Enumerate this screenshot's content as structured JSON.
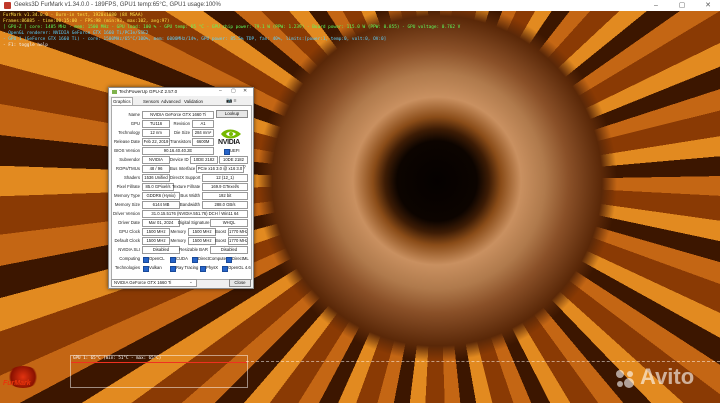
{
  "window": {
    "title": "Geeks3D FurMark v1.34.0.0 - 189FPS, GPU1 temp:65°C, GPU1 usage:100%",
    "controls": [
      "–",
      "▢",
      "✕"
    ]
  },
  "osd": {
    "line1": "FurMark v1.34.0.0 - Burn-in test, 1920x1080 (8X MSAA)",
    "line2": "Frames:86885 - time:00:15:00 - FPS:98 (min:93, max:102, avg:97)",
    "line3": "[ GPU-Z ] core: 1485 MHz - mem: 1500 MHz - GPU load: 100 % - GPU temp: 65 °C - GPU chip power: 79.1 W (PPW: 1.239) - Board power: 115.0 W (PPW: 0.855) - GPU voltage: 0.762 V",
    "line4": "- OpenGL renderer: NVIDIA GeForce GTX 1660 Ti/PCIe/SSE2",
    "line5": "- GPU 1 (GeForce GTX 1660 Ti) - core: 1500MHz/65°C/100%, mem: 6000MHz/14%, GPU power: 85.5% TDP, fan: 40%, limits:[power:1, temp:0, volt:0, OV:0]",
    "line6": "- F1: toggle help"
  },
  "graph": {
    "label": "GPU 1: 65°C (min: 51°C - max: 65°C)"
  },
  "logo": "FurMark",
  "watermark": "Avito",
  "gpuz": {
    "title": "TechPowerUp GPU-Z 2.57.0",
    "title_buttons": [
      "–",
      "▢",
      "✕"
    ],
    "tabs": [
      "Graphics Card",
      "Sensors",
      "Advanced",
      "Validation"
    ],
    "tab_icons": [
      "📷",
      "≡"
    ],
    "name_label": "Name",
    "name_value": "NVIDIA GeForce GTX 1660 Ti",
    "lookup": "Lookup",
    "gpu_label": "GPU",
    "gpu_value": "TU116",
    "revision_label": "Revision",
    "revision_value": "A1",
    "technology_label": "Technology",
    "technology_value": "12 nm",
    "diesize_label": "Die Size",
    "diesize_value": "284 mm²",
    "release_label": "Release Date",
    "release_value": "Feb 22, 2019",
    "transistors_label": "Transistors",
    "transistors_value": "6600M",
    "bios_label": "BIOS Version",
    "bios_value": "90.16.40.40.2E",
    "uefi": "UEFI",
    "subvendor_label": "Subvendor",
    "subvendor_value": "NVIDIA",
    "deviceid_label": "Device ID",
    "deviceid_value1": "10DE 2182",
    "deviceid_value2": "10DE 2182",
    "rops_label": "ROPs/TMUs",
    "rops_value": "48 / 96",
    "businterface_label": "Bus Interface",
    "businterface_value": "PCIe x16 3.0 @ x16 3.0",
    "shaders_label": "Shaders",
    "shaders_value": "1536 Unified",
    "directx_label": "DirectX Support",
    "directx_value": "12 (12_1)",
    "pixelfill_label": "Pixel Fillrate",
    "pixelfill_value": "85.0 GPixel/s",
    "texturefill_label": "Texture Fillrate",
    "texturefill_value": "169.9 GTexel/s",
    "memtype_label": "Memory Type",
    "memtype_value": "GDDR6 (Hynix)",
    "buswidth_label": "Bus Width",
    "buswidth_value": "192 bit",
    "memsize_label": "Memory Size",
    "memsize_value": "6144 MB",
    "bandwidth_label": "Bandwidth",
    "bandwidth_value": "288.0 GB/s",
    "driverver_label": "Driver Version",
    "driverver_value": "31.0.15.5176 (NVIDIA 551.76) DCH / Win11 64",
    "driverdate_label": "Driver Date",
    "driverdate_value": "Mar 01, 2024",
    "digsig_label": "Digital Signature",
    "digsig_value": "WHQL",
    "gpuclock_label": "GPU Clock",
    "gpuclock_value": "1500 MHz",
    "memory_label": "Memory",
    "memory_value": "1500 MHz",
    "boost_label": "Boost",
    "boost_value": "1770 MHz",
    "defclock_label": "Default Clock",
    "defclock_value": "1500 MHz",
    "defmemory_value": "1500 MHz",
    "defboost_value": "1770 MHz",
    "sli_label": "NVIDIA SLI",
    "sli_value": "Disabled",
    "resbar_label": "Resizable BAR",
    "resbar_value": "Disabled",
    "computing_label": "Computing",
    "computing": [
      "OpenCL",
      "CUDA",
      "DirectCompute",
      "DirectML"
    ],
    "technologies_label": "Technologies",
    "technologies": [
      "Vulkan",
      "Ray Tracing",
      "PhysX",
      "OpenGL 4.6"
    ],
    "nvidia_logo": "NVIDIA",
    "selected_gpu": "NVIDIA GeForce GTX 1660 Ti",
    "close": "Close"
  }
}
